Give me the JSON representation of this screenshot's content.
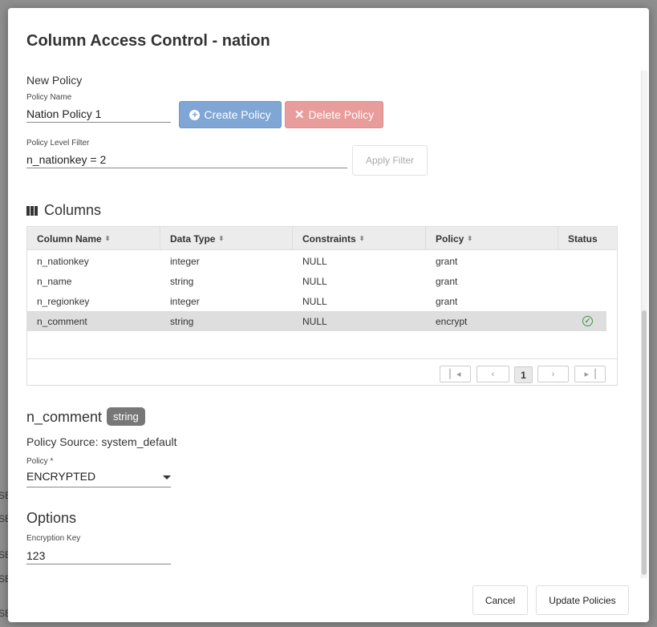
{
  "background_rows": [
    "SE",
    "SE",
    "SE",
    "SE",
    "SE"
  ],
  "modal": {
    "title": "Column Access Control - nation"
  },
  "new_policy": {
    "heading": "New Policy",
    "name_label": "Policy Name",
    "name_value": "Nation Policy 1",
    "create_label": "Create Policy",
    "delete_label": "Delete Policy",
    "filter_label": "Policy Level Filter",
    "filter_value": "n_nationkey = 2",
    "apply_label": "Apply Filter"
  },
  "columns": {
    "heading": "Columns",
    "headers": [
      "Column Name",
      "Data Type",
      "Constraints",
      "Policy",
      "Status"
    ],
    "rows": [
      {
        "name": "n_nationkey",
        "type": "integer",
        "constraints": "NULL",
        "policy": "grant",
        "status": ""
      },
      {
        "name": "n_name",
        "type": "string",
        "constraints": "NULL",
        "policy": "grant",
        "status": ""
      },
      {
        "name": "n_regionkey",
        "type": "integer",
        "constraints": "NULL",
        "policy": "grant",
        "status": ""
      },
      {
        "name": "n_comment",
        "type": "string",
        "constraints": "NULL",
        "policy": "encrypt",
        "status": "ok"
      }
    ],
    "selected_row": 3,
    "pager": {
      "current_page": "1"
    }
  },
  "detail": {
    "column_name": "n_comment",
    "column_type": "string",
    "policy_source": "Policy Source: system_default",
    "policy_label": "Policy *",
    "policy_value": "ENCRYPTED",
    "options_heading": "Options",
    "key_label": "Encryption Key",
    "key_value": "123"
  },
  "footer": {
    "cancel_label": "Cancel",
    "update_label": "Update Policies"
  },
  "colors": {
    "create_button": "#7fa6d4",
    "delete_button": "#e89c9c",
    "status_ok": "#3a9a4a",
    "badge": "#777777"
  }
}
